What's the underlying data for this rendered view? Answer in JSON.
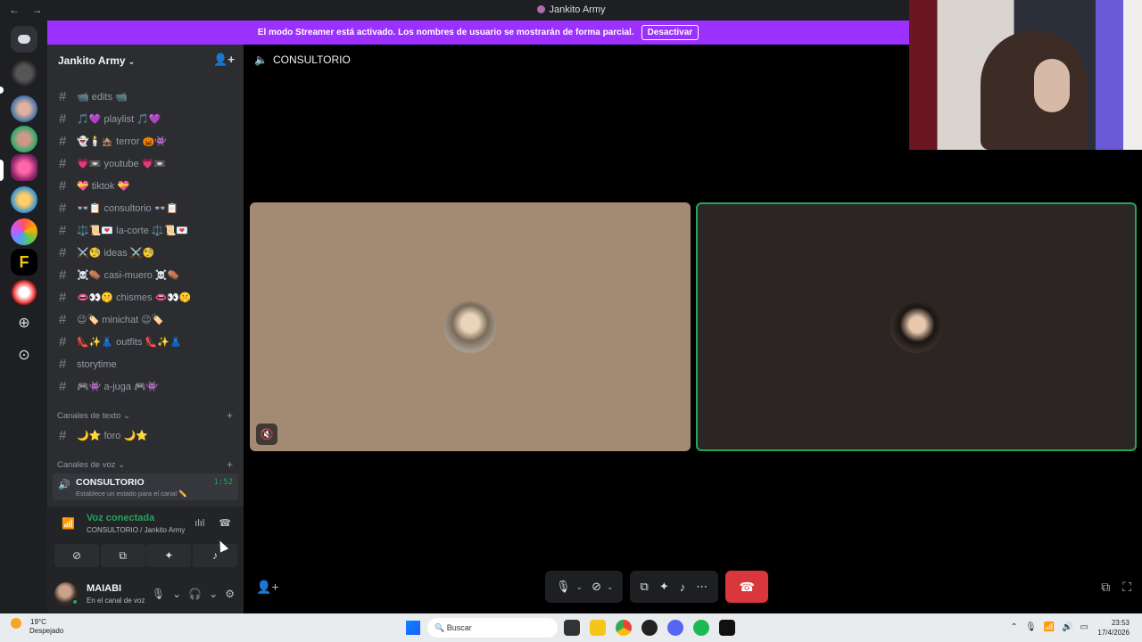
{
  "window": {
    "title": "Jankito Army",
    "back": "←",
    "forward": "→"
  },
  "streamer_banner": {
    "text": "El modo Streamer está activado. Los nombres de usuario se mostrarán de forma parcial.",
    "button": "Desactivar"
  },
  "server": {
    "name": "Jankito Army",
    "chevron": "⌄",
    "invite_icon": "👤+"
  },
  "channels": [
    {
      "name": "📹 edits 📹"
    },
    {
      "name": "🎵💜 playlist 🎵💜"
    },
    {
      "name": "👻🕯️🏚️ terror 🎃👾"
    },
    {
      "name": "💗📼 youtube 💗📼"
    },
    {
      "name": "💝 tiktok 💝"
    },
    {
      "name": "👓📋 consultorio 👓📋"
    },
    {
      "name": "⚖️📜💌 la-corte ⚖️📜💌"
    },
    {
      "name": "⚔️🧐 ideas ⚔️🧐"
    },
    {
      "name": "☠️⚰️ casi-muero ☠️⚰️"
    },
    {
      "name": "👄👀🤫 chismes 👄👀🤫"
    },
    {
      "name": "😉🏷️ minichat 😉🏷️"
    },
    {
      "name": "👠✨👗 outfits 👠✨👗"
    },
    {
      "name": "storytime"
    },
    {
      "name": "🎮👾 a-juga 🎮👾"
    }
  ],
  "categories": {
    "text": "Canales de texto",
    "voice": "Canales de voz"
  },
  "forum_channel": {
    "name": "🌙⭐ foro 🌙⭐"
  },
  "voice_channel": {
    "name": "CONSULTORIO",
    "time": "1:52",
    "status_placeholder": "Establece un estado para el canal ✏️"
  },
  "voice_panel": {
    "title": "Voz conectada",
    "subtitle": "CONSULTORIO / Jankito Army"
  },
  "user": {
    "name": "MAIABI",
    "status": "En el canal de voz"
  },
  "call": {
    "channel_title": "CONSULTORIO",
    "participants": [
      {
        "tile": "left",
        "muted": true
      },
      {
        "tile": "right",
        "speaking": true
      }
    ]
  },
  "taskbar": {
    "temp": "19°C",
    "condition": "Despejado",
    "search_placeholder": "Buscar",
    "time": "23:53",
    "date": "17/4/2026"
  },
  "colors": {
    "accent_streamer": "#9b30ff",
    "speaking": "#23a55a",
    "hangup": "#da373c",
    "left_tile": "#a28a73",
    "right_tile": "#2b2624"
  }
}
